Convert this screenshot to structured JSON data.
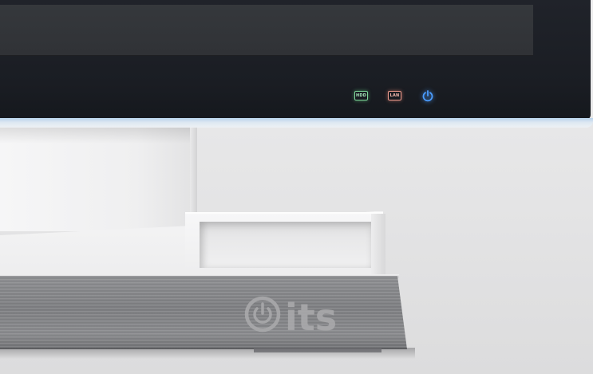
{
  "monitor": {
    "indicators": [
      {
        "label": "HDD",
        "color": "#7fd79a"
      },
      {
        "label": "LAN",
        "color": "#ef9c8e"
      }
    ],
    "power_led": {
      "icon": "power-icon",
      "color": "#4a9cff"
    }
  },
  "stand": {
    "brand": {
      "text": "its",
      "logo_icon": "power-icon",
      "color": "#a9a9ab"
    }
  }
}
